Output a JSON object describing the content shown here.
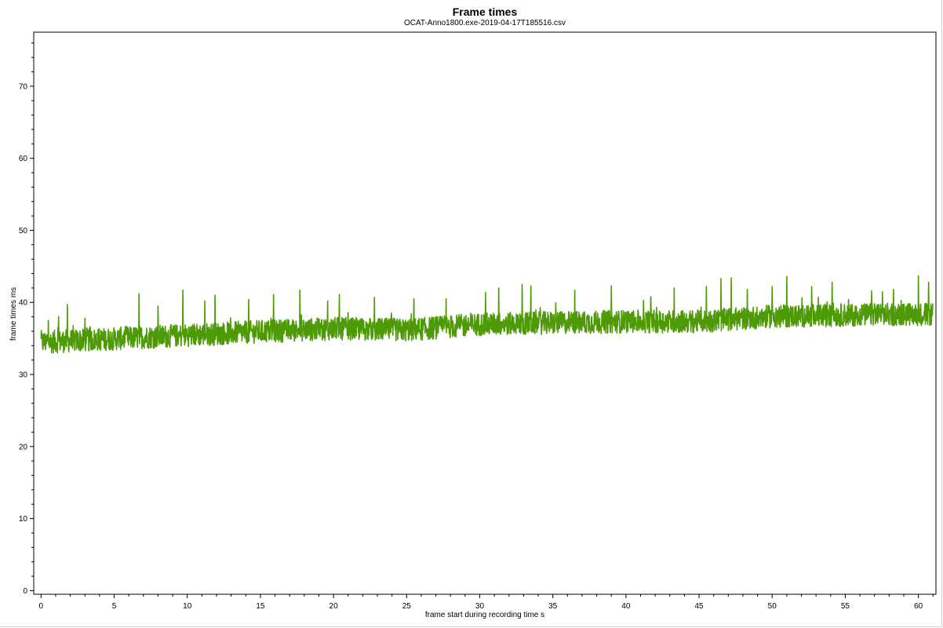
{
  "chart_data": {
    "type": "line",
    "title": "Frame times",
    "subtitle": "OCAT-Anno1800.exe-2019-04-17T185516.csv",
    "xlabel": "frame start during recording time s",
    "ylabel": "frame times ms",
    "xlim": [
      -0.5,
      61.2
    ],
    "ylim": [
      -0.5,
      77.5
    ],
    "xticks": [
      0,
      5,
      10,
      15,
      20,
      25,
      30,
      35,
      40,
      45,
      50,
      55,
      60
    ],
    "yticks": [
      0,
      10,
      20,
      30,
      40,
      50,
      60,
      70
    ],
    "grid": false,
    "series": [
      {
        "color": "#4e9a06",
        "baseline": {
          "x": [
            0,
            5,
            10,
            15,
            20,
            25,
            30,
            35,
            40,
            45,
            50,
            55,
            61
          ],
          "y": [
            34.3,
            34.8,
            35.3,
            35.8,
            36.2,
            36.0,
            36.8,
            37.0,
            37.2,
            37.2,
            37.9,
            38.1,
            38.2
          ]
        },
        "noise_amplitude_ms": 1.6,
        "spikes": {
          "x": [
            0.5,
            1.2,
            1.8,
            3.0,
            6.7,
            8.0,
            9.7,
            11.2,
            11.9,
            14.2,
            15.9,
            17.7,
            19.6,
            20.4,
            22.8,
            25.5,
            27.7,
            30.4,
            31.3,
            32.9,
            33.5,
            36.5,
            39.0,
            41.7,
            43.3,
            45.5,
            46.5,
            47.2,
            48.3,
            50.0,
            51.0,
            52.7,
            54.1,
            56.8,
            58.3,
            60.0,
            60.7
          ],
          "y": [
            37.5,
            38.0,
            39.7,
            37.8,
            41.2,
            39.5,
            41.7,
            40.2,
            41.0,
            40.4,
            41.1,
            41.7,
            40.2,
            41.1,
            40.7,
            40.5,
            40.5,
            41.4,
            42.0,
            42.5,
            42.3,
            41.7,
            42.3,
            40.8,
            42.0,
            42.2,
            43.3,
            43.4,
            41.8,
            42.2,
            43.6,
            42.2,
            42.8,
            41.6,
            41.8,
            43.7,
            42.8
          ]
        }
      }
    ]
  }
}
